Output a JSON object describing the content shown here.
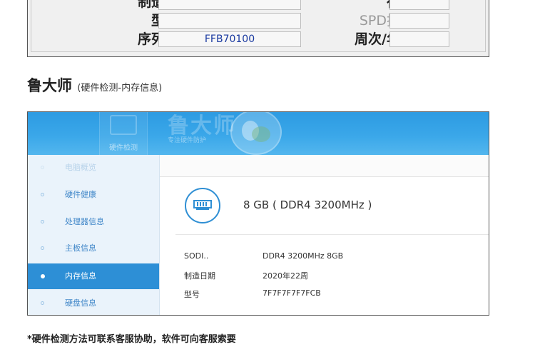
{
  "spd_panel": {
    "rows": [
      {
        "label": "制造商",
        "value": "",
        "right_label": "行列",
        "right_value": ""
      },
      {
        "label": "型号",
        "value": "",
        "right_label": "SPD扩展",
        "right_value": ""
      },
      {
        "label": "序列号",
        "value": "FFB70100",
        "right_label": "周次/年份",
        "right_value": ""
      }
    ]
  },
  "section": {
    "title": "鲁大师",
    "subtitle": "(硬件检测-内存信息)"
  },
  "app": {
    "header": {
      "tile_label": "硬件检测",
      "brand": "鲁大师",
      "tagline": "专注硬件防护"
    },
    "sidebar": {
      "items": [
        {
          "label": "电脑概览",
          "state": "faded"
        },
        {
          "label": "硬件健康",
          "state": "normal"
        },
        {
          "label": "处理器信息",
          "state": "normal"
        },
        {
          "label": "主板信息",
          "state": "normal"
        },
        {
          "label": "内存信息",
          "state": "active"
        },
        {
          "label": "硬盘信息",
          "state": "normal"
        }
      ]
    },
    "memory": {
      "summary": "8 GB ( DDR4 3200MHz )",
      "specs": [
        {
          "key": "SODI..",
          "value": "DDR4 3200MHz 8GB"
        },
        {
          "key": "制造日期",
          "value": "2020年22周"
        },
        {
          "key": "型号",
          "value": "7F7F7F7F7FCB"
        }
      ]
    }
  },
  "footnote": "*硬件检测方法可联系客服协助，软件可向客服索要",
  "colors": {
    "accent": "#2d8fd6",
    "header": "#3aa7e9",
    "sidebar": "#eaf3fb"
  }
}
